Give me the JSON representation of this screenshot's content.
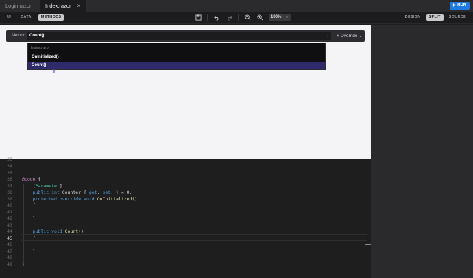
{
  "tabs": [
    {
      "label": "Login.razor"
    },
    {
      "label": "Index.razor",
      "close": "×"
    }
  ],
  "run_label": "RUN",
  "toolbar": {
    "left_pills": [
      "UI",
      "DATA",
      "METHODS"
    ],
    "zoom": "100%",
    "right_pills": [
      "DESIGN",
      "SPLIT",
      "SOURCE"
    ]
  },
  "method_bar": {
    "label": "Method:",
    "selected": "Count()",
    "override_label": "Override",
    "dropdown": {
      "header": "Index.razor",
      "items": [
        "OnInitialized()",
        "Count()"
      ]
    }
  },
  "editor": {
    "current_line": "45",
    "lines": [
      {
        "n": "33",
        "t": ""
      },
      {
        "n": "34",
        "t": ""
      },
      {
        "n": "35",
        "t": ""
      },
      {
        "n": "36",
        "t": "@code {"
      },
      {
        "n": "37",
        "t": "    [Parameter]"
      },
      {
        "n": "38",
        "t": "    public int Counter { get; set; } = 0;"
      },
      {
        "n": "39",
        "t": "    protected override void OnInitialized()"
      },
      {
        "n": "40",
        "t": "    {"
      },
      {
        "n": "41",
        "t": ""
      },
      {
        "n": "42",
        "t": "    }"
      },
      {
        "n": "43",
        "t": ""
      },
      {
        "n": "44",
        "t": "    public void Count()"
      },
      {
        "n": "45",
        "t": "    {"
      },
      {
        "n": "46",
        "t": ""
      },
      {
        "n": "47",
        "t": "    }"
      },
      {
        "n": "48",
        "t": ""
      },
      {
        "n": "49",
        "t": "}"
      }
    ]
  },
  "colors": {
    "accent": "#1f7ae0",
    "selection": "#2f2a6b"
  }
}
